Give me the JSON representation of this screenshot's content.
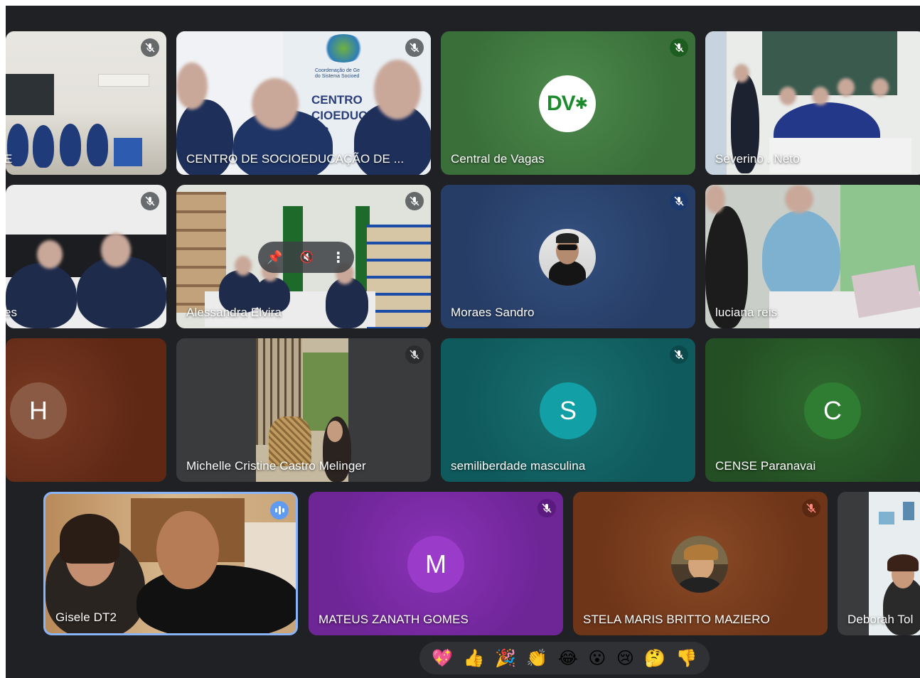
{
  "participants": [
    {
      "name": "E",
      "muted": true
    },
    {
      "name": "CENTRO DE SOCIOEDUCAÇÃO DE ...",
      "muted": true,
      "banner_text": "CENTRO\nCIOEDUC\nAR",
      "banner_small": "Coordenação de Ge\ndo Sistema Socioed"
    },
    {
      "name": "Central de Vagas",
      "muted": true,
      "logo_text": "DV",
      "color": "#3f7d3f"
    },
    {
      "name": "Severino . Neto",
      "muted": false
    },
    {
      "name": "es",
      "muted": true
    },
    {
      "name": "Alessandra Elvira",
      "muted": true
    },
    {
      "name": "Moraes Sandro",
      "muted": true,
      "color": "#263d66"
    },
    {
      "name": "luciana reis",
      "muted": false
    },
    {
      "name": "",
      "muted": false,
      "initial": "H",
      "color": "#6b2f1c"
    },
    {
      "name": "Michelle Cristine Castro Melinger",
      "muted": true
    },
    {
      "name": "semiliberdade masculina",
      "muted": true,
      "initial": "S",
      "color": "#0f5a5c"
    },
    {
      "name": "CENSE Paranavai",
      "muted": false,
      "initial": "C",
      "color": "#2b5d2b"
    },
    {
      "name": "Gisele DT2",
      "muted": false,
      "speaking": true
    },
    {
      "name": "MATEUS ZANATH GOMES",
      "muted": true,
      "initial": "M",
      "color": "#7a2aa3"
    },
    {
      "name": "STELA MARIS BRITTO MAZIERO",
      "muted": true,
      "color": "#7a3a1c"
    },
    {
      "name": "Deborah Tol",
      "muted": false
    }
  ],
  "reactions": [
    "💖",
    "👍",
    "🎉",
    "👏",
    "😂",
    "😮",
    "😢",
    "🤔",
    "👎"
  ]
}
